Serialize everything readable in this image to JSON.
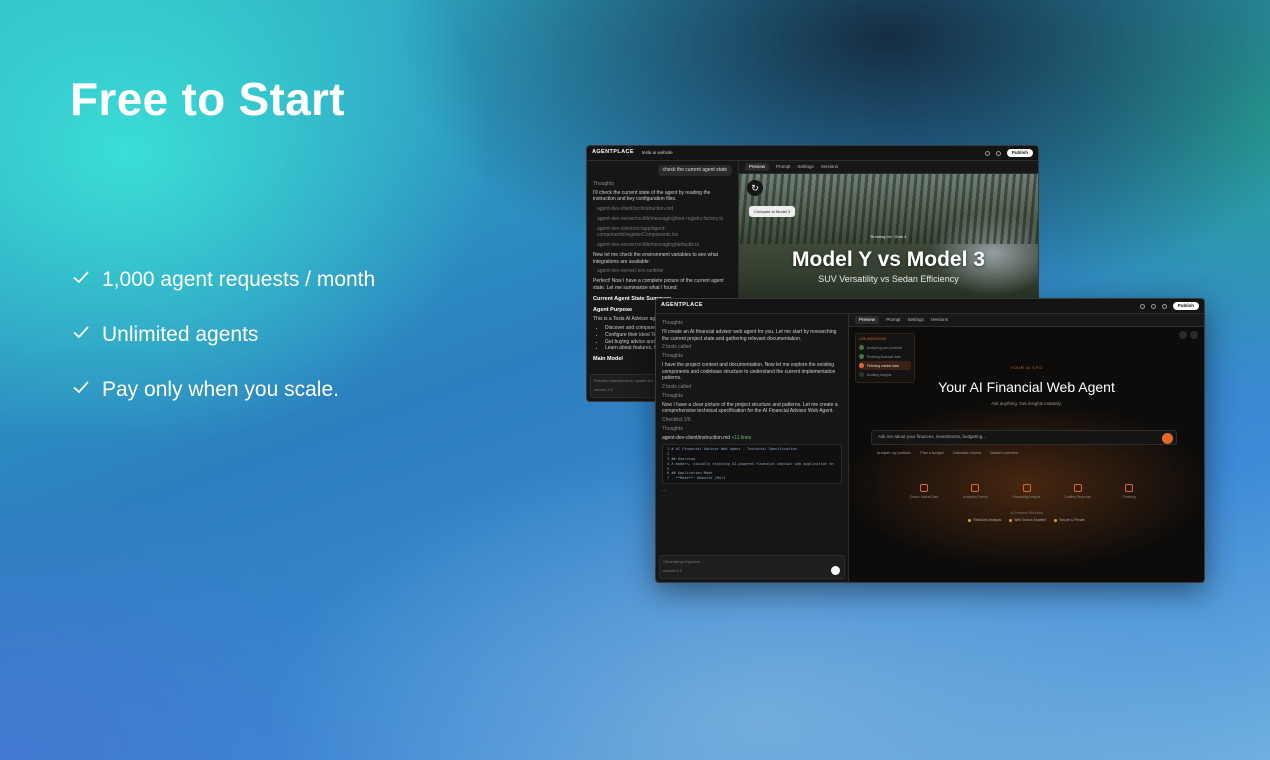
{
  "hero": {
    "title": "Free to Start",
    "features": [
      "1,000 agent requests / month",
      "Unlimited agents",
      "Pay only when you scale."
    ]
  },
  "back_window": {
    "brand": "AGENTPLACE",
    "project": "tesla ai website",
    "publish_label": "Publish",
    "tabs": [
      "Preview",
      "Prompt",
      "Settings",
      "Versions"
    ],
    "chat": {
      "user_message": "check the current agent state",
      "thoughts_label": "Thoughts",
      "para1": "I'll check the current state of the agent by reading the instruction and key configuration files.",
      "files": [
        "agent-dev-client/src/instruction.md",
        "agent-dev-server/src/lib/messaging/tool-registry.factory.ts",
        "agent-dev-client/src/app/agent-components/registerComponents.tsx",
        "agent-dev-server/src/lib/messaging/defaults.ts"
      ],
      "para2": "Now let me check the environment variables to see what integrations are available:",
      "file2": "agent-dev-server/.env.runtime",
      "para3": "Perfect! Now I have a complete picture of the current agent state. Let me summarize what I found:",
      "heading": "Current Agent State Summary",
      "subheading": "Agent Purpose",
      "purpose": "This is a Tesla AI Advisor agent",
      "bullets": [
        "Discover and compare Tesla",
        "Configure their ideal Tesla",
        "Get buying advice and spe",
        "Learn about features, finan"
      ],
      "main_model": "Main Model",
      "composer_placeholder": "Provide instructions to update the",
      "model_selector": "sonnet-4.5"
    },
    "preview": {
      "compare_button": "Compare to Model 3",
      "running_label": "Running on",
      "running_model": "Grok 4",
      "title": "Model Y vs Model 3",
      "subtitle": "SUV Versatility vs Sedan Efficiency"
    }
  },
  "front_window": {
    "brand": "AGENTPLACE",
    "publish_label": "Publish",
    "tabs": [
      "Preview",
      "Prompt",
      "Settings",
      "Versions"
    ],
    "chat": {
      "thoughts_label": "Thoughts",
      "para1": "I'll create an AI financial advisor web agent for you. Let me start by researching the current project state and gathering relevant documentation.",
      "tools1": "2 tools called",
      "para2": "I have the project context and documentation. Now let me explore the existing components and codebase structure to understand the current implementation patterns.",
      "tools2": "2 tools called",
      "para3": "Now I have a clear picture of the project structure and patterns. Let me create a comprehensive technical specification for the AI Financial Advisor Web Agent.",
      "checklist": "Checklist 1/6",
      "thoughts2": "Thoughts",
      "code_file": "agent-dev-client/instruction.md",
      "code_badge": "+11 lines",
      "code_lines": [
        "1  # AI Financial Advisor Web Agent - Technical Specification",
        "2",
        "3  ## Overview",
        "4  A modern, visually stunning AI-powered financial advisor web application th",
        "5",
        "6  ## Application Mode",
        "7  - **Mode**: Website (Mult"
      ],
      "more": "...",
      "generating": "Generating response...",
      "model_selector": "sonnet-4.5"
    },
    "preview": {
      "workflow_title": "LIVE WORKFLOW",
      "workflow_steps": [
        "Analyzing your portfolio",
        "Reading financial data",
        "Fetching market data",
        "Building insights"
      ],
      "kicker": "YOUR AI CFO",
      "title": "Your AI Financial Web Agent",
      "subtitle": "Ask anything. Get insights instantly.",
      "ask_placeholder": "Ask me about your finances, investments, budgeting...",
      "chips": [
        "Analyze my portfolio",
        "Plan a budget",
        "Calculate returns",
        "Market overview"
      ],
      "features": [
        {
          "label": "Search Market Data"
        },
        {
          "label": "Analyzing Trends"
        },
        {
          "label": "Processing Insights"
        },
        {
          "label": "Drafting Response"
        },
        {
          "label": "Finalizing"
        }
      ],
      "powered": "AI-Powered Workflow",
      "badges": [
        "Real-time Analysis",
        "Web Search Enabled",
        "Secure & Private"
      ]
    }
  }
}
